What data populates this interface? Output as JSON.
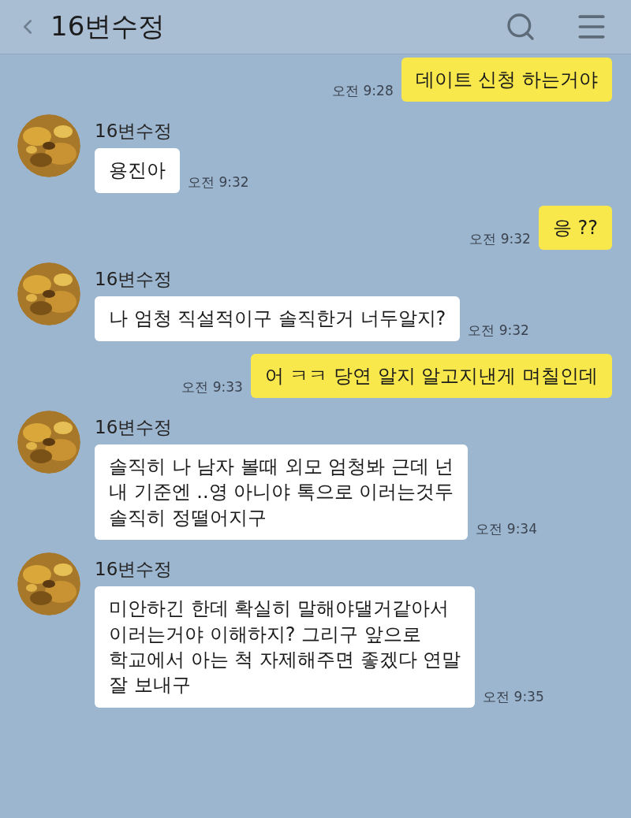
{
  "header": {
    "title": "16변수정"
  },
  "messages": [
    {
      "kind": "sent",
      "text": "데이트 신청 하는거야",
      "time": "오전 9:28"
    },
    {
      "kind": "received",
      "sender": "16변수정",
      "text": "용진아",
      "time": "오전 9:32"
    },
    {
      "kind": "sent",
      "text": "응 ??",
      "time": "오전 9:32"
    },
    {
      "kind": "received",
      "sender": "16변수정",
      "text": "나 엄청 직설적이구 솔직한거 너두알지?",
      "time": "오전 9:32"
    },
    {
      "kind": "sent",
      "text": "어 ㅋㅋ 당연 알지 알고지낸게 며칠인데",
      "time": "오전 9:33"
    },
    {
      "kind": "received",
      "sender": "16변수정",
      "text": "솔직히 나 남자 볼때 외모 엄청봐 근데 넌\n내 기준엔 ..영 아니야 톡으로 이러는것두\n솔직히 정떨어지구",
      "time": "오전 9:34"
    },
    {
      "kind": "received",
      "sender": "16변수정",
      "text": "미안하긴 한데 확실히 말해야댈거같아서\n이러는거야 이해하지? 그리구 앞으로\n학교에서 아는 척 자제해주면 좋겠다 연말\n잘 보내구",
      "time": "오전 9:35"
    }
  ]
}
